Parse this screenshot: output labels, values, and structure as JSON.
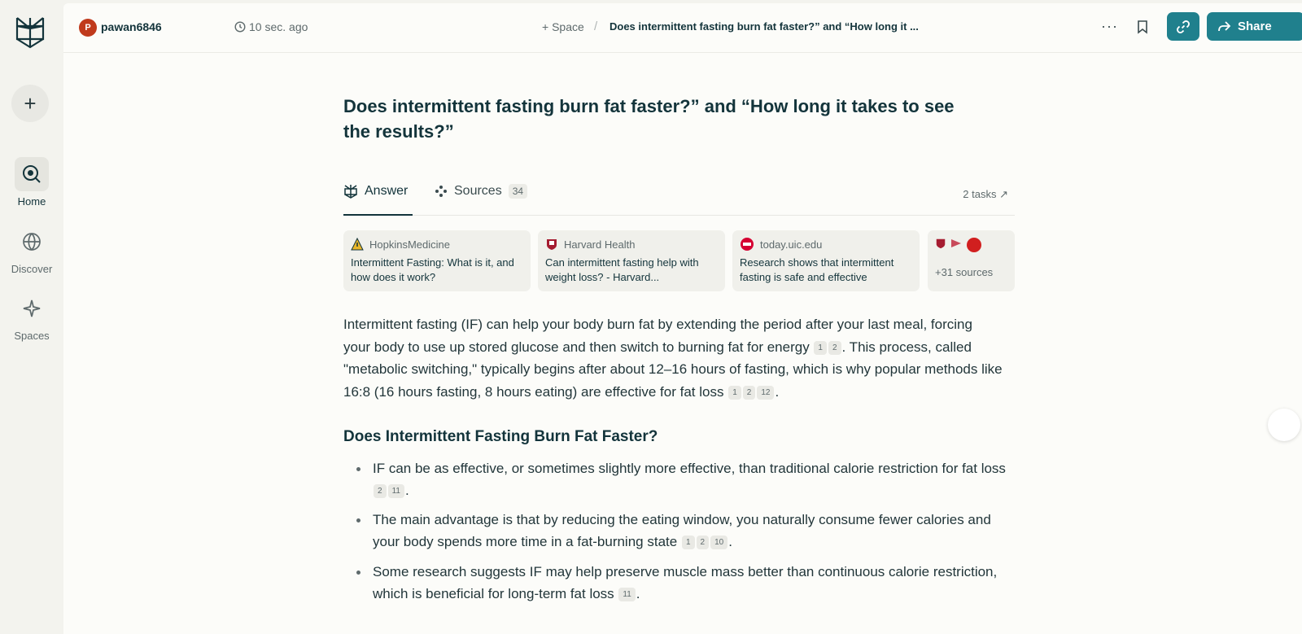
{
  "sidebar": {
    "items": [
      {
        "label": "Home"
      },
      {
        "label": "Discover"
      },
      {
        "label": "Spaces"
      }
    ]
  },
  "header": {
    "avatar_letter": "P",
    "username": "pawan6846",
    "time_ago": "10 sec. ago",
    "space_link": "+ Space",
    "separator": "/",
    "thread_title": "Does intermittent fasting burn fat faster?” and “How long it ...",
    "more": "···",
    "share_label": "Share"
  },
  "question": "Does intermittent fasting burn fat faster?” and “How long it takes to see the results?”",
  "tabs": {
    "answer": "Answer",
    "sources": "Sources",
    "sources_count": "34",
    "tasks": "2 tasks ↗"
  },
  "source_cards": [
    {
      "site": "HopkinsMedicine",
      "title": "Intermittent Fasting: What is it, and how does it work?",
      "color": "#e9b62a"
    },
    {
      "site": "Harvard Health",
      "title": "Can intermittent fasting help with weight loss? - Harvard...",
      "color": "#a51c30"
    },
    {
      "site": "today.uic.edu",
      "title": "Research shows that intermittent fasting is safe and effective",
      "color": "#d50032"
    },
    {
      "more": "+31 sources"
    }
  ],
  "paragraph": {
    "t1": "Intermittent fasting (IF) can help your body burn fat by extending the period after your last meal, forcing your body to use up stored glucose and then switch to burning fat for energy ",
    "c1": "1",
    "c2": "2",
    "t2": ". This process, called \"metabolic switching,\" typically begins after about 12–16 hours of fasting, which is why popular methods like 16:8 (16 hours fasting, 8 hours eating) are effective for fat loss ",
    "c3": "1",
    "c4": "2",
    "c5": "12",
    "t3": "."
  },
  "section_heading": "Does Intermittent Fasting Burn Fat Faster?",
  "bullets": [
    {
      "text": "IF can be as effective, or sometimes slightly more effective, than traditional calorie restriction for fat loss ",
      "cites": [
        "2",
        "11"
      ]
    },
    {
      "text": "The main advantage is that by reducing the eating window, you naturally consume fewer calories and your body spends more time in a fat-burning state ",
      "cites": [
        "1",
        "2",
        "10"
      ]
    },
    {
      "text": "Some research suggests IF may help preserve muscle mass better than continuous calorie restriction, which is beneficial for long-term fat loss ",
      "cites": [
        "11"
      ]
    }
  ],
  "colors": {
    "accent": "#20808d",
    "text": "#13343b",
    "avatar": "#c03a1c"
  }
}
